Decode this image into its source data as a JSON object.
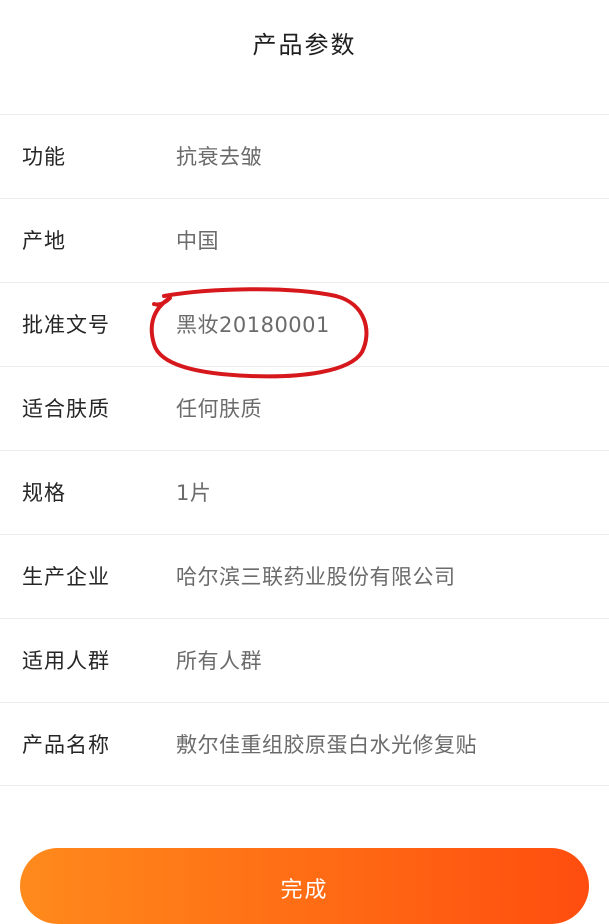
{
  "header": {
    "title": "产品参数"
  },
  "params": [
    {
      "label": "功能",
      "value": "抗衰去皱"
    },
    {
      "label": "产地",
      "value": "中国"
    },
    {
      "label": "批准文号",
      "value": "黑妆20180001"
    },
    {
      "label": "适合肤质",
      "value": "任何肤质"
    },
    {
      "label": "规格",
      "value": "1片"
    },
    {
      "label": "生产企业",
      "value": "哈尔滨三联药业股份有限公司"
    },
    {
      "label": "适用人群",
      "value": "所有人群"
    },
    {
      "label": "产品名称",
      "value": "敷尔佳重组胶原蛋白水光修复贴"
    }
  ],
  "footer": {
    "done_label": "完成"
  },
  "colors": {
    "accent_start": "#ff8a1c",
    "accent_end": "#ff4d0f",
    "annotation_red": "#d6181c"
  }
}
